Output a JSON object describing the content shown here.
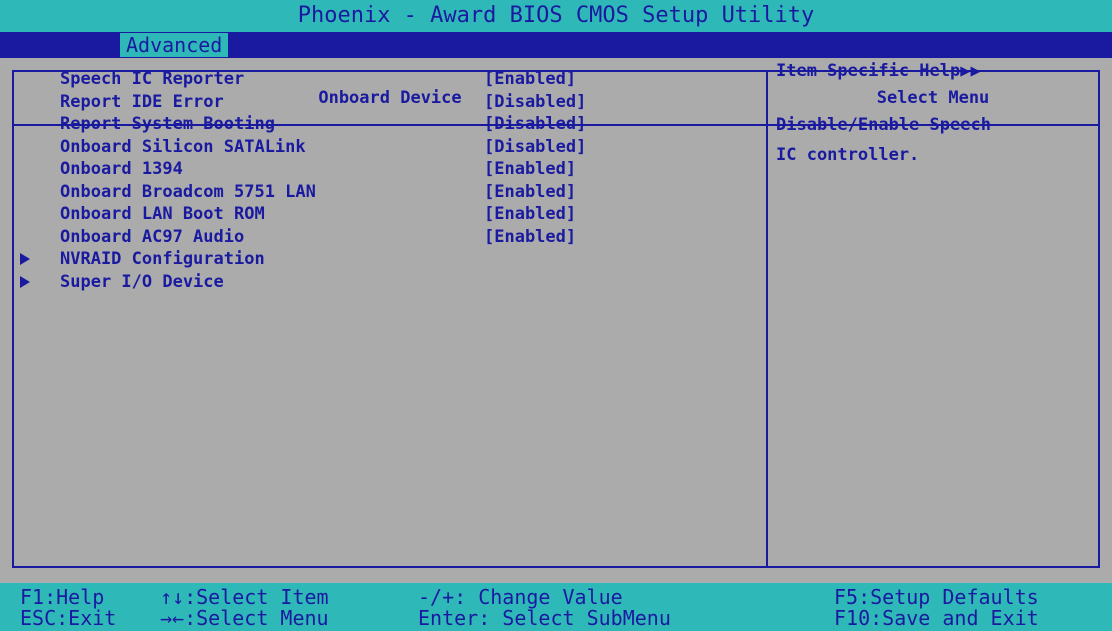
{
  "window": {
    "title": "Phoenix - Award BIOS CMOS Setup Utility"
  },
  "menu": {
    "active_tab": "Advanced"
  },
  "panel": {
    "header": "Onboard Device",
    "settings": [
      {
        "label": "Speech IC Reporter",
        "value": "[Enabled]"
      },
      {
        "label": "Report IDE Error",
        "value": "[Disabled]"
      },
      {
        "label": "Report System Booting",
        "value": "[Disabled]"
      },
      {
        "label": "Onboard Silicon SATALink",
        "value": "[Disabled]"
      },
      {
        "label": "Onboard 1394",
        "value": "[Enabled]"
      },
      {
        "label": "Onboard Broadcom 5751 LAN",
        "value": "[Enabled]"
      },
      {
        "label": "Onboard LAN Boot ROM",
        "value": "[Enabled]"
      },
      {
        "label": "Onboard AC97 Audio",
        "value": "[Enabled]"
      }
    ],
    "submenus": [
      {
        "label": "NVRAID Configuration"
      },
      {
        "label": "Super I/O Device"
      }
    ]
  },
  "help": {
    "header": "Select Menu",
    "title": "Item Specific Help▶▶",
    "line1": "Disable/Enable Speech",
    "line2": "IC controller."
  },
  "footer": {
    "f1": "F1:Help",
    "esc": "ESC:Exit",
    "select_item": "↑↓:Select Item",
    "select_menu": "→←:Select Menu",
    "change_value": "-/+: Change Value",
    "select_submenu": "Enter: Select SubMenu",
    "f5": "F5:Setup Defaults",
    "f10": "F10:Save and Exit"
  },
  "colors": {
    "accent_cyan": "#2fb8b8",
    "text_blue": "#1a1aa0",
    "panel_gray": "#ababab"
  }
}
